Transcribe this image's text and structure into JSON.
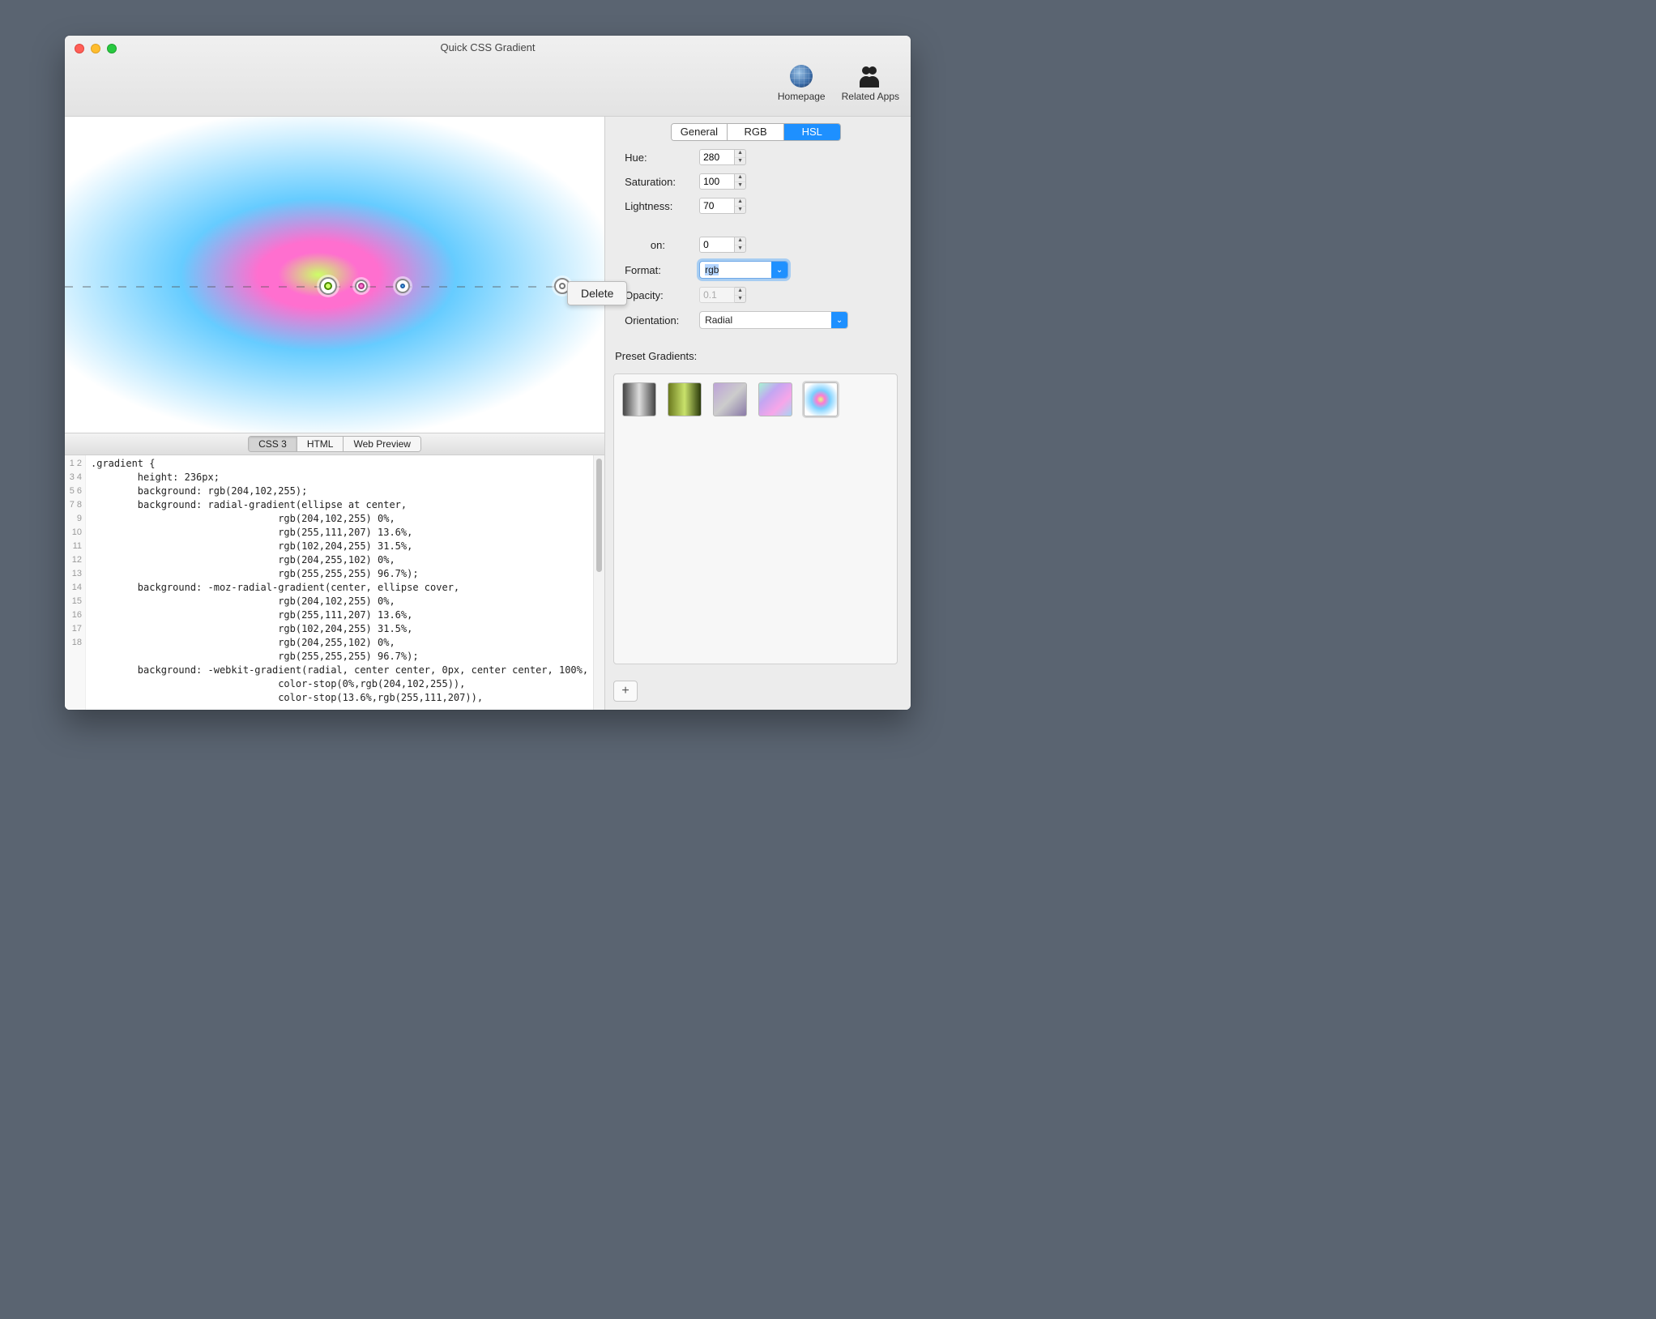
{
  "window": {
    "title": "Quick CSS Gradient"
  },
  "toolbar": {
    "homepage": "Homepage",
    "related": "Related Apps"
  },
  "popover": {
    "delete": "Delete"
  },
  "code_tabs": {
    "css3": "CSS 3",
    "html": "HTML",
    "web_preview": "Web Preview",
    "active": "css3"
  },
  "code_lines": [
    ".gradient {",
    "        height: 236px;",
    "        background: rgb(204,102,255);",
    "        background: radial-gradient(ellipse at center,",
    "                                rgb(204,102,255) 0%,",
    "                                rgb(255,111,207) 13.6%,",
    "                                rgb(102,204,255) 31.5%,",
    "                                rgb(204,255,102) 0%,",
    "                                rgb(255,255,255) 96.7%);",
    "        background: -moz-radial-gradient(center, ellipse cover,",
    "                                rgb(204,102,255) 0%,",
    "                                rgb(255,111,207) 13.6%,",
    "                                rgb(102,204,255) 31.5%,",
    "                                rgb(204,255,102) 0%,",
    "                                rgb(255,255,255) 96.7%);",
    "        background: -webkit-gradient(radial, center center, 0px, center center, 100%,",
    "                                color-stop(0%,rgb(204,102,255)),",
    "                                color-stop(13.6%,rgb(255,111,207)),"
  ],
  "hsl_panel": {
    "tabs": {
      "general": "General",
      "rgb": "RGB",
      "hsl": "HSL"
    },
    "hue_label": "Hue:",
    "hue": "280",
    "sat_label": "Saturation:",
    "sat": "100",
    "light_label": "Lightness:",
    "light": "70"
  },
  "stop_panel": {
    "position_label_suffix": "on:",
    "position": "0",
    "format_label": "Format:",
    "format_value": "rgb",
    "opacity_label": "Opacity:",
    "opacity": "0.1",
    "orientation_label": "Orientation:",
    "orientation_value": "Radial"
  },
  "presets": {
    "label": "Preset Gradients:"
  },
  "add_btn": "+"
}
